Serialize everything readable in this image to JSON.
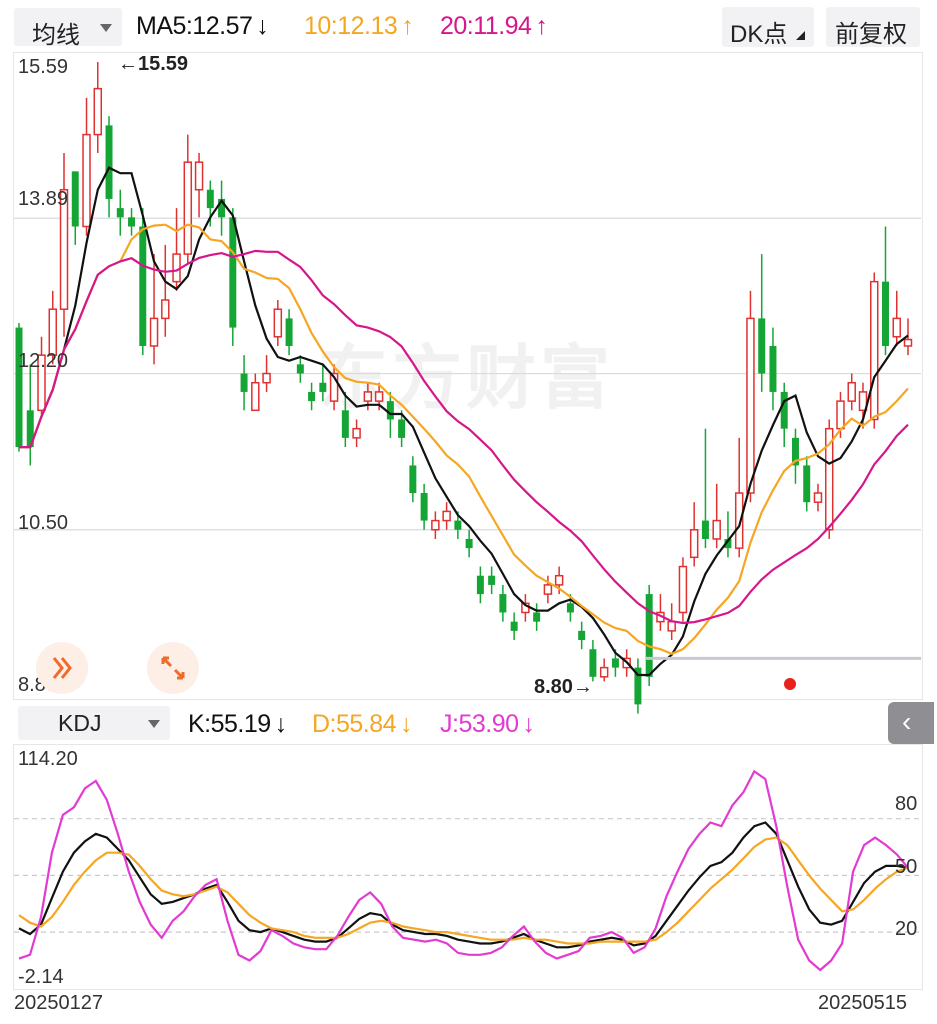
{
  "top": {
    "type_select": "均线",
    "ma5": "MA5:12.57",
    "ma5_arrow": "↓",
    "ma10": "10:12.13",
    "ma10_arrow": "↑",
    "ma20": "20:11.94",
    "ma20_arrow": "↑",
    "dk_button": "DK点",
    "fq_button": "前复权"
  },
  "kdj_bar": {
    "select": "KDJ",
    "k": "K:55.19",
    "k_arrow": "↓",
    "d": "D:55.84",
    "d_arrow": "↓",
    "j": "J:53.90",
    "j_arrow": "↓",
    "collapse_glyph": "‹"
  },
  "watermark": "东方财富",
  "colors": {
    "up": "#e03131",
    "down": "#14a535",
    "ma5": "#111111",
    "ma10": "#f5a623",
    "ma20": "#d6168c",
    "k": "#111111",
    "d": "#f5a623",
    "j": "#e33ad1"
  },
  "chart_data": [
    {
      "type": "candlestick",
      "title": "",
      "y_ticks": [
        "15.59",
        "13.89",
        "12.20",
        "10.50",
        "8.80"
      ],
      "ylim": [
        8.8,
        15.59
      ],
      "high_label": "←15.59",
      "low_label": "8.80→",
      "start_date": "20250127",
      "end_date": "20250515",
      "candles": [
        [
          12.7,
          11.4,
          12.75,
          11.35
        ],
        [
          11.8,
          11.4,
          12.3,
          11.2
        ],
        [
          11.8,
          12.4,
          12.6,
          11.75
        ],
        [
          12.4,
          12.9,
          13.1,
          12.3
        ],
        [
          12.9,
          14.2,
          14.6,
          12.6
        ],
        [
          14.4,
          13.8,
          14.4,
          13.6
        ],
        [
          13.8,
          14.8,
          15.2,
          13.7
        ],
        [
          14.8,
          15.3,
          15.59,
          14.6
        ],
        [
          14.9,
          14.1,
          15.0,
          13.9
        ],
        [
          14.0,
          13.9,
          14.2,
          13.7
        ],
        [
          13.9,
          13.8,
          14.0,
          13.7
        ],
        [
          13.8,
          12.5,
          14.0,
          12.4
        ],
        [
          12.5,
          12.8,
          13.5,
          12.3
        ],
        [
          12.8,
          13.0,
          13.6,
          12.6
        ],
        [
          13.2,
          13.5,
          14.0,
          13.1
        ],
        [
          13.5,
          14.5,
          14.8,
          13.4
        ],
        [
          14.2,
          14.5,
          14.6,
          13.9
        ],
        [
          14.2,
          14.0,
          14.3,
          13.8
        ],
        [
          14.1,
          13.9,
          14.3,
          13.7
        ],
        [
          13.9,
          12.7,
          14.0,
          12.5
        ],
        [
          12.2,
          12.0,
          12.4,
          11.8
        ],
        [
          11.8,
          12.1,
          12.2,
          11.8
        ],
        [
          12.1,
          12.2,
          12.4,
          12.0
        ],
        [
          12.6,
          12.9,
          13.0,
          12.5
        ],
        [
          12.8,
          12.5,
          12.9,
          12.4
        ],
        [
          12.3,
          12.2,
          12.4,
          12.1
        ],
        [
          12.0,
          11.9,
          12.1,
          11.8
        ],
        [
          12.1,
          12.0,
          12.3,
          11.9
        ],
        [
          11.9,
          12.2,
          12.3,
          11.8
        ],
        [
          11.8,
          11.5,
          12.0,
          11.4
        ],
        [
          11.5,
          11.6,
          11.7,
          11.4
        ],
        [
          11.9,
          12.0,
          12.1,
          11.8
        ],
        [
          11.9,
          12.0,
          12.1,
          11.8
        ],
        [
          11.9,
          11.7,
          12.0,
          11.5
        ],
        [
          11.7,
          11.5,
          11.8,
          11.4
        ],
        [
          11.2,
          10.9,
          11.3,
          10.8
        ],
        [
          10.9,
          10.6,
          11.0,
          10.5
        ],
        [
          10.5,
          10.6,
          10.7,
          10.4
        ],
        [
          10.6,
          10.7,
          10.8,
          10.5
        ],
        [
          10.6,
          10.5,
          10.7,
          10.4
        ],
        [
          10.4,
          10.3,
          10.5,
          10.2
        ],
        [
          10.0,
          9.8,
          10.1,
          9.7
        ],
        [
          10.0,
          9.9,
          10.1,
          9.8
        ],
        [
          9.8,
          9.6,
          9.9,
          9.5
        ],
        [
          9.5,
          9.4,
          9.6,
          9.3
        ],
        [
          9.6,
          9.7,
          9.8,
          9.5
        ],
        [
          9.6,
          9.5,
          9.7,
          9.4
        ],
        [
          9.8,
          9.9,
          10.0,
          9.7
        ],
        [
          9.9,
          10.0,
          10.1,
          9.8
        ],
        [
          9.7,
          9.6,
          9.8,
          9.5
        ],
        [
          9.4,
          9.3,
          9.5,
          9.2
        ],
        [
          9.2,
          8.9,
          9.3,
          8.85
        ],
        [
          8.9,
          9.0,
          9.1,
          8.85
        ],
        [
          9.1,
          9.0,
          9.2,
          8.9
        ],
        [
          9.0,
          9.1,
          9.2,
          8.9
        ],
        [
          9.0,
          8.6,
          9.1,
          8.5
        ],
        [
          9.8,
          8.9,
          9.9,
          8.8
        ],
        [
          9.5,
          9.6,
          9.8,
          9.4
        ],
        [
          9.4,
          9.5,
          9.7,
          9.3
        ],
        [
          9.6,
          10.1,
          10.2,
          9.5
        ],
        [
          10.2,
          10.5,
          10.8,
          10.1
        ],
        [
          10.6,
          10.4,
          11.6,
          10.3
        ],
        [
          10.4,
          10.6,
          11.0,
          10.3
        ],
        [
          10.4,
          10.3,
          10.7,
          10.2
        ],
        [
          10.3,
          10.9,
          11.5,
          10.2
        ],
        [
          10.9,
          12.8,
          13.1,
          10.8
        ],
        [
          12.8,
          12.2,
          13.5,
          12.0
        ],
        [
          12.5,
          12.0,
          12.7,
          11.8
        ],
        [
          12.0,
          11.6,
          12.1,
          11.4
        ],
        [
          11.5,
          11.2,
          11.6,
          11.0
        ],
        [
          11.2,
          10.8,
          11.3,
          10.7
        ],
        [
          10.8,
          10.9,
          11.0,
          10.7
        ],
        [
          10.5,
          11.6,
          11.7,
          10.4
        ],
        [
          11.6,
          11.9,
          12.0,
          11.5
        ],
        [
          11.9,
          12.1,
          12.2,
          11.8
        ],
        [
          11.8,
          12.0,
          12.1,
          11.6
        ],
        [
          11.7,
          13.2,
          13.3,
          11.6
        ],
        [
          13.2,
          12.5,
          13.8,
          12.4
        ],
        [
          12.6,
          12.8,
          13.1,
          12.5
        ],
        [
          12.5,
          12.57,
          12.8,
          12.4
        ]
      ]
    },
    {
      "type": "line",
      "title": "",
      "y_ticks": [
        "114.20",
        "80",
        "50",
        "20",
        "-2.14"
      ],
      "ylim": [
        -2.14,
        114.2
      ],
      "series": [
        {
          "name": "K",
          "values": [
            22,
            19,
            24,
            38,
            52,
            62,
            68,
            72,
            70,
            64,
            58,
            49,
            40,
            35,
            36,
            38,
            40,
            43,
            45,
            36,
            26,
            21,
            20,
            22,
            20,
            18,
            16,
            15,
            15,
            17,
            22,
            27,
            30,
            29,
            24,
            21,
            20,
            19,
            19,
            18,
            16,
            15,
            14,
            14,
            15,
            17,
            19,
            16,
            14,
            12,
            12,
            13,
            15,
            16,
            17,
            16,
            13,
            14,
            18,
            26,
            34,
            42,
            49,
            55,
            57,
            62,
            70,
            76,
            78,
            72,
            58,
            44,
            32,
            25,
            24,
            26,
            36,
            46,
            52,
            55,
            55,
            54
          ]
        },
        {
          "name": "D",
          "values": [
            29,
            25,
            23,
            28,
            36,
            45,
            52,
            58,
            62,
            62,
            61,
            55,
            48,
            42,
            40,
            39,
            40,
            42,
            44,
            41,
            35,
            29,
            25,
            22,
            21,
            20,
            18,
            17,
            17,
            17,
            19,
            22,
            25,
            26,
            25,
            23,
            22,
            21,
            20,
            20,
            19,
            18,
            17,
            16,
            16,
            16,
            17,
            16,
            16,
            15,
            14,
            14,
            14,
            15,
            15,
            15,
            15,
            15,
            16,
            20,
            25,
            31,
            37,
            43,
            48,
            53,
            59,
            65,
            69,
            70,
            66,
            58,
            50,
            43,
            37,
            31,
            32,
            37,
            43,
            48,
            52,
            54
          ]
        },
        {
          "name": "J",
          "values": [
            6,
            8,
            28,
            62,
            82,
            86,
            96,
            100,
            90,
            72,
            52,
            36,
            24,
            17,
            26,
            31,
            39,
            45,
            48,
            26,
            8,
            5,
            10,
            21,
            18,
            14,
            12,
            11,
            11,
            18,
            28,
            37,
            41,
            35,
            23,
            17,
            16,
            15,
            16,
            14,
            9,
            8,
            8,
            9,
            12,
            18,
            23,
            15,
            9,
            6,
            8,
            10,
            17,
            18,
            20,
            17,
            9,
            12,
            22,
            39,
            52,
            64,
            72,
            78,
            76,
            87,
            94,
            105,
            101,
            76,
            44,
            16,
            5,
            0,
            5,
            14,
            52,
            66,
            70,
            66,
            61,
            54
          ]
        }
      ]
    }
  ]
}
